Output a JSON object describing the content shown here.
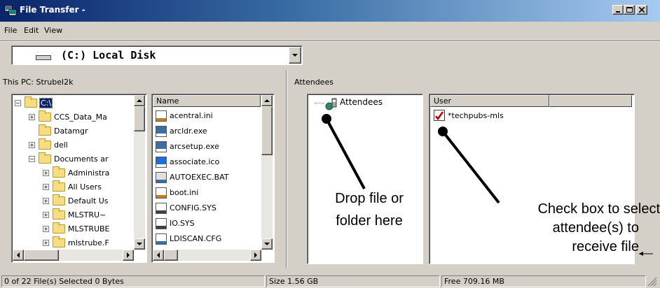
{
  "window": {
    "title": "File Transfer -",
    "buttons": {
      "minimize": "_",
      "maximize": "□",
      "close": "×"
    }
  },
  "menu": {
    "items": [
      "File",
      "Edit",
      "View"
    ]
  },
  "drive_combo": {
    "value": "(C:) Local Disk"
  },
  "local_panel": {
    "title": "This PC: Strubel2k",
    "tree": [
      {
        "label": "C:\\",
        "level": 0,
        "expander": "−",
        "selected": true
      },
      {
        "label": "CCS_Data_Ma",
        "level": 1,
        "expander": "+"
      },
      {
        "label": "Datamgr",
        "level": 1,
        "expander": ""
      },
      {
        "label": "dell",
        "level": 1,
        "expander": "+"
      },
      {
        "label": "Documents ar",
        "level": 1,
        "expander": "−"
      },
      {
        "label": "Administra",
        "level": 2,
        "expander": "+"
      },
      {
        "label": "All Users",
        "level": 2,
        "expander": "+"
      },
      {
        "label": "Default Us",
        "level": 2,
        "expander": "+"
      },
      {
        "label": "MLSTRU~",
        "level": 2,
        "expander": "+"
      },
      {
        "label": "MLSTRUBE",
        "level": 2,
        "expander": "+"
      },
      {
        "label": "mlstrube.F",
        "level": 2,
        "expander": "+"
      }
    ],
    "file_list": {
      "header": "Name",
      "files": [
        "acentral.ini",
        "arcldr.exe",
        "arcsetup.exe",
        "associate.ico",
        "AUTOEXEC.BAT",
        "boot.ini",
        "CONFIG.SYS",
        "IO.SYS",
        "LDISCAN.CFG"
      ]
    }
  },
  "attendees_panel": {
    "title": "Attendees",
    "tree_root": "Attendees",
    "user_list": {
      "header": "User",
      "users": [
        {
          "name": "*techpubs-mls",
          "checked": true
        }
      ]
    }
  },
  "annotations": {
    "drop": [
      "Drop file or",
      "folder here"
    ],
    "check": [
      "Check box to select",
      "attendee(s) to",
      "receive file"
    ]
  },
  "status": {
    "selection": "0 of 22 File(s) Selected 0 Bytes",
    "size": "Size 1.56 GB",
    "free": "Free 709.16 MB"
  },
  "colors": {
    "titlebar_start": "#0a246a",
    "titlebar_end": "#a6caf0",
    "face": "#d4d0c8",
    "selection": "#0a246a",
    "folder": "#f7dd7f"
  }
}
